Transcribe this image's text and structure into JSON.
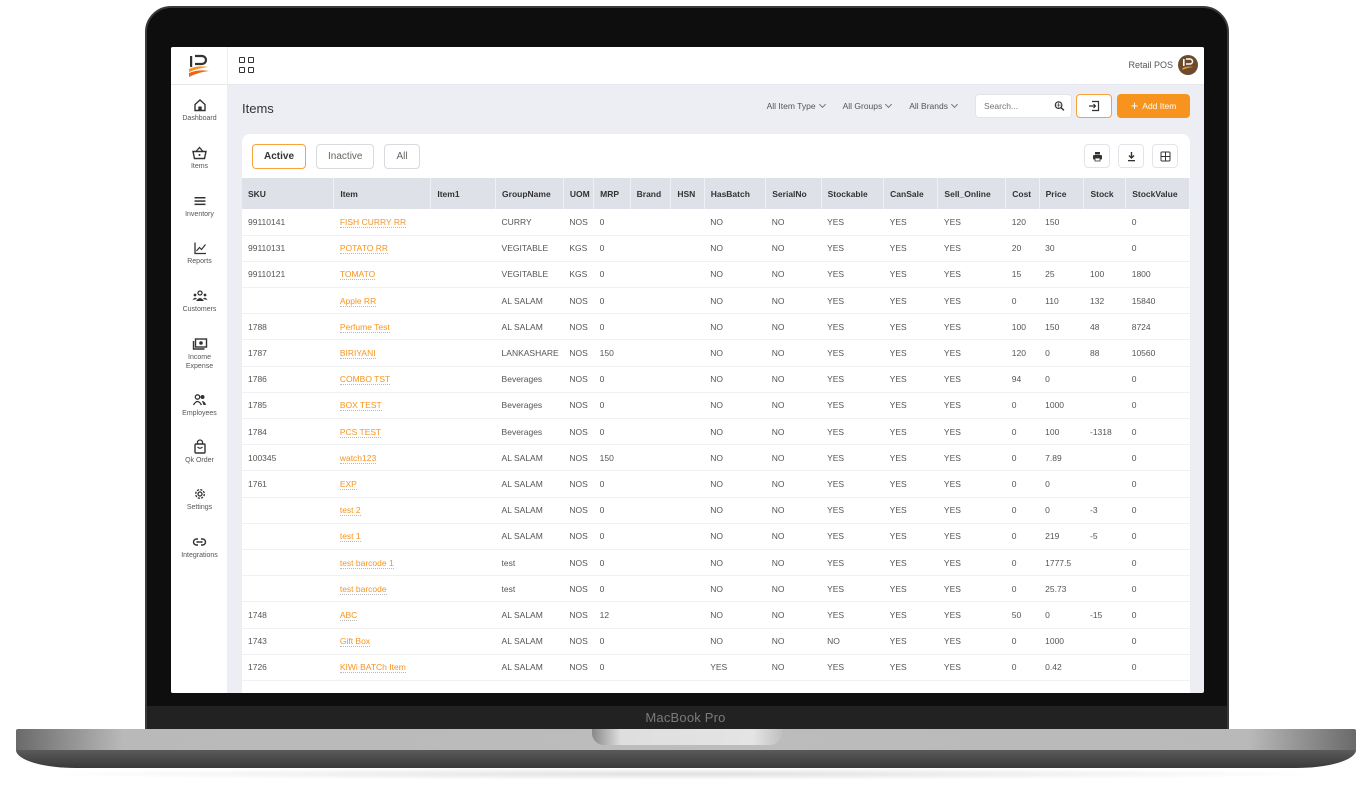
{
  "device": {
    "label": "MacBook Pro"
  },
  "topbar": {
    "brand": "Retail POS"
  },
  "sidebar": {
    "items": [
      {
        "label": "Dashboard",
        "icon": "home-icon"
      },
      {
        "label": "Items",
        "icon": "basket-icon"
      },
      {
        "label": "Inventory",
        "icon": "list-icon"
      },
      {
        "label": "Reports",
        "icon": "chart-icon"
      },
      {
        "label": "Customers",
        "icon": "users-icon"
      },
      {
        "label": "Income Expense",
        "icon": "cash-icon"
      },
      {
        "label": "Employees",
        "icon": "employees-icon"
      },
      {
        "label": "Qk Order",
        "icon": "bag-icon"
      },
      {
        "label": "Settings",
        "icon": "gear-icon"
      },
      {
        "label": "Integrations",
        "icon": "link-icon"
      }
    ]
  },
  "page": {
    "title": "Items"
  },
  "filters": {
    "item_type": "All Item Type",
    "groups": "All Groups",
    "brands": "All Brands",
    "search_placeholder": "Search...",
    "add_label": "Add Item"
  },
  "tabs": [
    {
      "label": "Active",
      "active": true
    },
    {
      "label": "Inactive",
      "active": false
    },
    {
      "label": "All",
      "active": false
    }
  ],
  "table": {
    "columns": [
      "SKU",
      "Item",
      "Item1",
      "GroupName",
      "UOM",
      "MRP",
      "Brand",
      "HSN",
      "HasBatch",
      "SerialNo",
      "Stockable",
      "CanSale",
      "Sell_Online",
      "Cost",
      "Price",
      "Stock",
      "StockValue"
    ],
    "rows": [
      [
        "99110141",
        "FISH CURRY RR",
        "",
        "CURRY",
        "NOS",
        "0",
        "",
        "",
        "NO",
        "NO",
        "YES",
        "YES",
        "YES",
        "120",
        "150",
        "",
        "0"
      ],
      [
        "99110131",
        "POTATO RR",
        "",
        "VEGITABLE",
        "KGS",
        "0",
        "",
        "",
        "NO",
        "NO",
        "YES",
        "YES",
        "YES",
        "20",
        "30",
        "",
        "0"
      ],
      [
        "99110121",
        "TOMATO",
        "",
        "VEGITABLE",
        "KGS",
        "0",
        "",
        "",
        "NO",
        "NO",
        "YES",
        "YES",
        "YES",
        "15",
        "25",
        "100",
        "1800"
      ],
      [
        "",
        "Apple RR",
        "",
        "AL SALAM",
        "NOS",
        "0",
        "",
        "",
        "NO",
        "NO",
        "YES",
        "YES",
        "YES",
        "0",
        "110",
        "132",
        "15840"
      ],
      [
        "1788",
        "Perfume Test",
        "",
        "AL SALAM",
        "NOS",
        "0",
        "",
        "",
        "NO",
        "NO",
        "YES",
        "YES",
        "YES",
        "100",
        "150",
        "48",
        "8724"
      ],
      [
        "1787",
        "BIRIYANI",
        "",
        "LANKASHARE",
        "NOS",
        "150",
        "",
        "",
        "NO",
        "NO",
        "YES",
        "YES",
        "YES",
        "120",
        "0",
        "88",
        "10560"
      ],
      [
        "1786",
        "COMBO TST",
        "",
        "Beverages",
        "NOS",
        "0",
        "",
        "",
        "NO",
        "NO",
        "YES",
        "YES",
        "YES",
        "94",
        "0",
        "",
        "0"
      ],
      [
        "1785",
        "BOX TEST",
        "",
        "Beverages",
        "NOS",
        "0",
        "",
        "",
        "NO",
        "NO",
        "YES",
        "YES",
        "YES",
        "0",
        "1000",
        "",
        "0"
      ],
      [
        "1784",
        "PCS TEST",
        "",
        "Beverages",
        "NOS",
        "0",
        "",
        "",
        "NO",
        "NO",
        "YES",
        "YES",
        "YES",
        "0",
        "100",
        "-1318",
        "0"
      ],
      [
        "100345",
        "watch123",
        "",
        "AL SALAM",
        "NOS",
        "150",
        "",
        "",
        "NO",
        "NO",
        "YES",
        "YES",
        "YES",
        "0",
        "7.89",
        "",
        "0"
      ],
      [
        "1761",
        "EXP",
        "",
        "AL SALAM",
        "NOS",
        "0",
        "",
        "",
        "NO",
        "NO",
        "YES",
        "YES",
        "YES",
        "0",
        "0",
        "",
        "0"
      ],
      [
        "",
        "test 2",
        "",
        "AL SALAM",
        "NOS",
        "0",
        "",
        "",
        "NO",
        "NO",
        "YES",
        "YES",
        "YES",
        "0",
        "0",
        "-3",
        "0"
      ],
      [
        "",
        "test 1",
        "",
        "AL SALAM",
        "NOS",
        "0",
        "",
        "",
        "NO",
        "NO",
        "YES",
        "YES",
        "YES",
        "0",
        "219",
        "-5",
        "0"
      ],
      [
        "",
        "test barcode 1",
        "",
        "test",
        "NOS",
        "0",
        "",
        "",
        "NO",
        "NO",
        "YES",
        "YES",
        "YES",
        "0",
        "1777.5",
        "",
        "0"
      ],
      [
        "",
        "test barcode",
        "",
        "test",
        "NOS",
        "0",
        "",
        "",
        "NO",
        "NO",
        "YES",
        "YES",
        "YES",
        "0",
        "25.73",
        "",
        "0"
      ],
      [
        "1748",
        "ABC",
        "",
        "AL SALAM",
        "NOS",
        "12",
        "",
        "",
        "NO",
        "NO",
        "YES",
        "YES",
        "YES",
        "50",
        "0",
        "-15",
        "0"
      ],
      [
        "1743",
        "Gift Box",
        "",
        "AL SALAM",
        "NOS",
        "0",
        "",
        "",
        "NO",
        "NO",
        "NO",
        "YES",
        "YES",
        "0",
        "1000",
        "",
        "0"
      ],
      [
        "1726",
        "KIWi BATCh Item",
        "",
        "AL SALAM",
        "NOS",
        "0",
        "",
        "",
        "YES",
        "NO",
        "YES",
        "YES",
        "YES",
        "0",
        "0.42",
        "",
        "0"
      ]
    ]
  },
  "colors": {
    "accent": "#f7941d",
    "header_bg": "#dfe1e8",
    "page_bg": "#eceef4"
  }
}
